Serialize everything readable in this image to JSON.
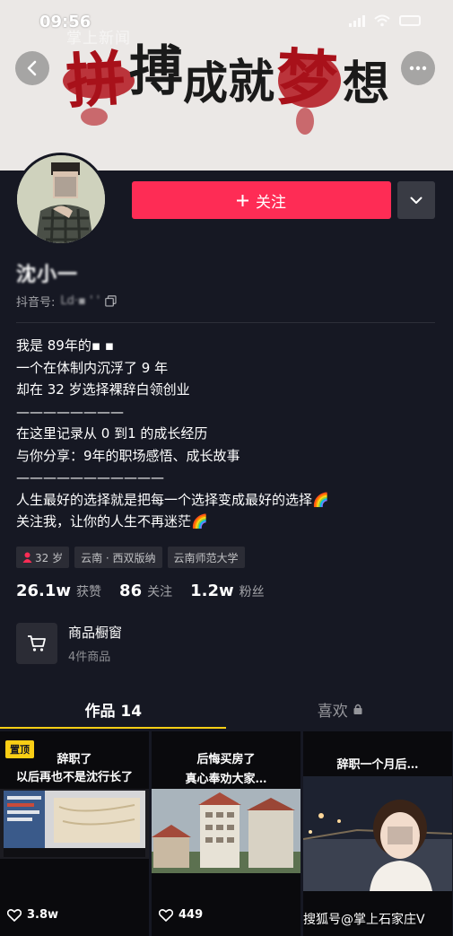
{
  "status_bar": {
    "time": "09:56"
  },
  "banner": {
    "title_chars": [
      "拼",
      "搏",
      "成",
      "就",
      "梦",
      "想"
    ],
    "watermark": "掌上新闻",
    "back_icon": "chevron-left-icon",
    "more_icon": "ellipsis-icon"
  },
  "profile": {
    "follow_label": "关注",
    "follow_icon": "plus-icon",
    "nickname": "沈小一",
    "douyin_id_label": "抖音号:",
    "douyin_id_value": "Ld·▪ ' ' ",
    "bio": [
      "我是 89年的▪ ▪ ",
      "一个在体制内沉浮了 9 年",
      "却在 32 岁选择裸辞白领创业",
      "————————",
      "在这里记录从 0 到1 的成长经历",
      "与你分享：9年的职场感悟、成长故事",
      "———————————",
      "人生最好的选择就是把每一个选择变成最好的选择🌈",
      "关注我，让你的人生不再迷茫🌈"
    ],
    "tags": [
      "32 岁",
      "云南 · 西双版纳",
      "云南师范大学"
    ],
    "stats": [
      {
        "num": "26.1w",
        "label": "获赞"
      },
      {
        "num": "86",
        "label": "关注"
      },
      {
        "num": "1.2w",
        "label": "粉丝"
      }
    ],
    "shop": {
      "title": "商品橱窗",
      "subtitle": "4件商品"
    }
  },
  "tabs": [
    {
      "label": "作品 14"
    },
    {
      "label": "喜欢"
    }
  ],
  "videos": [
    {
      "pinned_label": "置顶",
      "caption": [
        "辞职了",
        "以后再也不是沈行长了"
      ],
      "likes": "3.8w"
    },
    {
      "caption": [
        "后悔买房了",
        "真心奉劝大家…"
      ],
      "likes": "449"
    },
    {
      "caption": [
        "辞职一个月后…"
      ],
      "likes": ""
    }
  ],
  "watermark_bottom": "搜狐号@掌上石家庄V",
  "colors": {
    "accent": "#fe2c55",
    "background": "#161823",
    "tab_indicator": "#face15",
    "banner_red": "#b3141c"
  }
}
